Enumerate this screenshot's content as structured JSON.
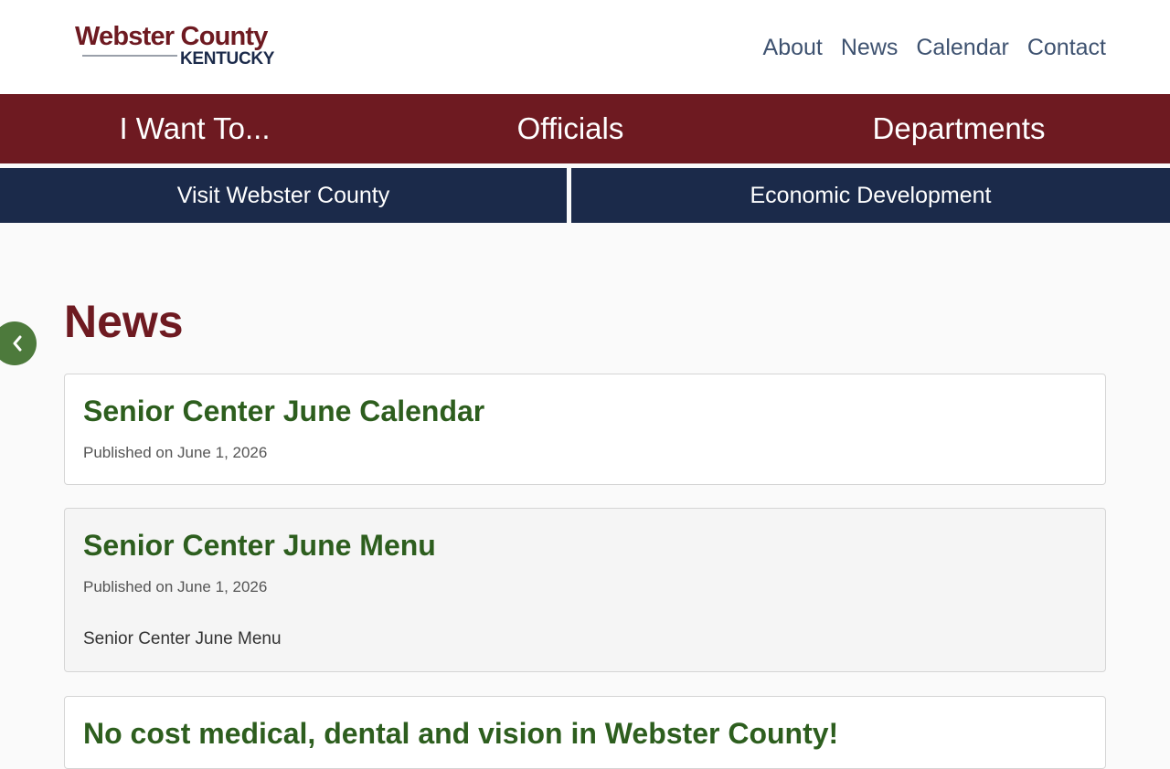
{
  "header": {
    "logo_title": "Webster County",
    "logo_subtitle": "KENTUCKY",
    "nav": [
      "About",
      "News",
      "Calendar",
      "Contact"
    ]
  },
  "primary_nav": [
    "I Want To...",
    "Officials",
    "Departments"
  ],
  "secondary_nav": [
    "Visit Webster County",
    "Economic Development"
  ],
  "side_tab": {
    "icon": "chevron-left-icon"
  },
  "main": {
    "title": "News",
    "articles": [
      {
        "title": "Senior Center June Calendar",
        "meta": "Published on June 1, 2026",
        "summary": ""
      },
      {
        "title": "Senior Center June Menu",
        "meta": "Published on June 1, 2026",
        "summary": "Senior Center June Menu"
      },
      {
        "title": "No cost medical, dental and vision in Webster County!",
        "meta": "",
        "summary": ""
      }
    ]
  },
  "colors": {
    "brand_red": "#6e1a21",
    "brand_navy": "#1b2a4a",
    "link_green": "#2d5e1e",
    "tab_green": "#4d7a3c",
    "nav_slate": "#3e5270"
  }
}
